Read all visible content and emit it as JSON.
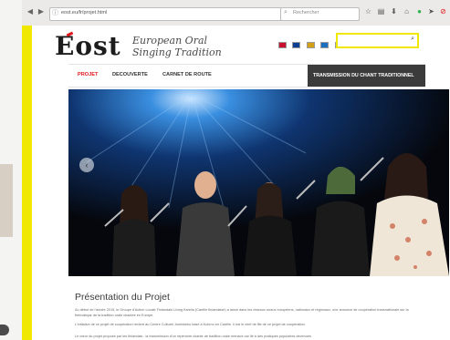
{
  "browser": {
    "url": "eost.eu/fr/projet.html",
    "search_placeholder": "Rechercher",
    "back_icon": "back-arrow-icon",
    "forward_icon": "forward-arrow-icon"
  },
  "site": {
    "logo_text": "Eost",
    "tagline_line1": "European Oral",
    "tagline_line2": "Singing Tradition",
    "flag_colors": [
      "#c8102e",
      "#0b3d91",
      "#d4a017",
      "#1e6fbf",
      "#c8102e",
      "#2b5bb0",
      "#f2c200",
      "#5a5a5a"
    ],
    "accent_color": "#e0161c",
    "stripe_color": "#f1e800"
  },
  "menu": {
    "items": [
      "PROJET",
      "DECOUVERTE",
      "CARNET DE ROUTE"
    ],
    "right_label": "TRANSMISSION DU CHANT TRADITIONNEL"
  },
  "content": {
    "title": "Présentation du Projet",
    "para1": "Au début de l'année 2015, le Groupe d'Action Locale Finlandais Living Karelia (Carélie finlandaise) a lancé dans les réseaux ruraux européens, nationaux et régionaux, une annonce de coopération transnationale sur la thématique de la tradition orale chantée en Europe.",
    "para2": "L'initiative de ce projet de coopération revient au Centre Culturel Juminkeko basé à Kuhmo en Carélie. Il est le chef de file de ce projet de coopération.",
    "para3": "Le cœur du projet proposé par les finlandais : la transmission d'un répertoire chanté de tradition orale menacé car lié à des pratiques populaires devenues"
  }
}
